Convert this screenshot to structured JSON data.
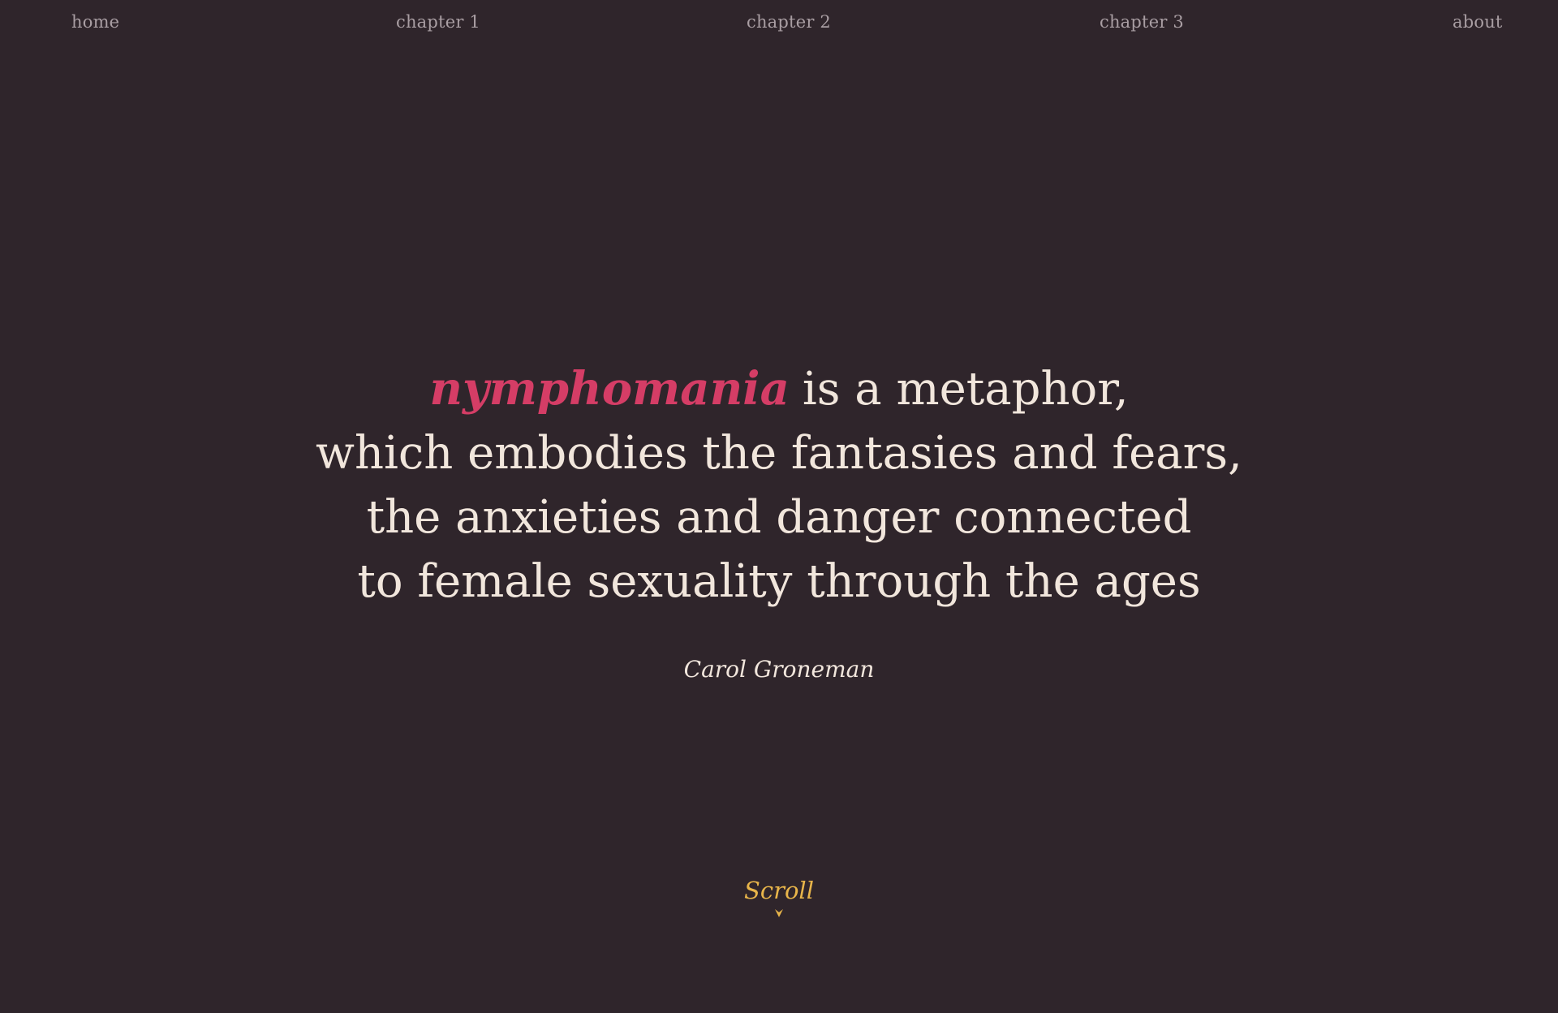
{
  "nav": {
    "home": "home",
    "chapter1": "chapter 1",
    "chapter2": "chapter 2",
    "chapter3": "chapter 3",
    "about": "about"
  },
  "quote": {
    "highlight": "nymphomania",
    "line1_rest": "is a metaphor,",
    "line2": "which embodies the fantasies and fears,",
    "line3": "the anxieties and danger connected",
    "line4": "to female sexuality through the ages"
  },
  "author": "Carol Groneman",
  "scroll": {
    "label": "Scroll",
    "icon": "chevron-down-icon"
  },
  "colors": {
    "background": "#2f252b",
    "nav_text": "#a99ea3",
    "quote_text": "#f1e6dc",
    "accent": "#d53d66",
    "scroll": "#e8b54a"
  }
}
